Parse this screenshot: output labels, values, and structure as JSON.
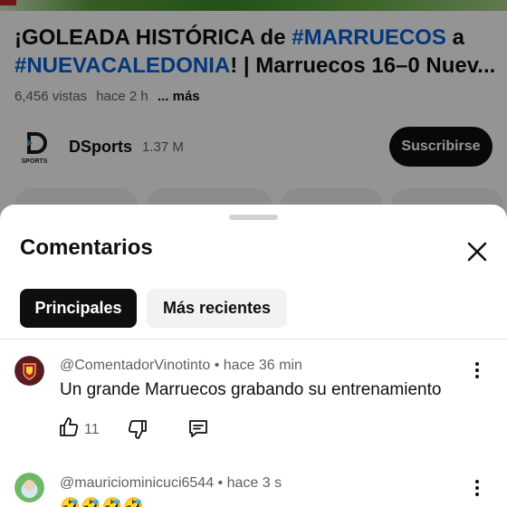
{
  "video": {
    "title_line1": "¡GOLEADA HISTÓRICA de ",
    "title_hashtag1": "#MARRUECOS",
    "title_line1_end": " a",
    "title_hashtag2": "#NUEVACALEDONIA",
    "title_line2_rest": "! | Marruecos 16–0 Nuev...",
    "views": "6,456 vistas",
    "time": "hace 2 h",
    "more_label": "... más"
  },
  "channel": {
    "name": "DSports",
    "subscribers": "1.37 M",
    "subscribe_label": "Suscribirse"
  },
  "comments_panel": {
    "title": "Comentarios",
    "filters": [
      "Principales",
      "Más recientes"
    ],
    "active_filter": "Principales",
    "comments": [
      {
        "author": "@ComentadorVinotinto",
        "time": "hace 36 min",
        "text": "Un grande Marruecos grabando su entrenamiento",
        "likes": "11"
      },
      {
        "author": "@mauriciominicuci6544",
        "time": "hace 3 s",
        "text": "🤣🤣🤣🤣"
      }
    ]
  },
  "colors": {
    "accent_link": "#065fd4",
    "text_primary": "#0f0f0f",
    "text_secondary": "#606060",
    "chip_active_bg": "#0f0f0f",
    "chip_inactive_bg": "#f2f2f2"
  },
  "icons": [
    "close-icon",
    "thumbs-up-icon",
    "thumbs-down-icon",
    "reply-icon",
    "more-vert-icon",
    "dsports-logo"
  ]
}
